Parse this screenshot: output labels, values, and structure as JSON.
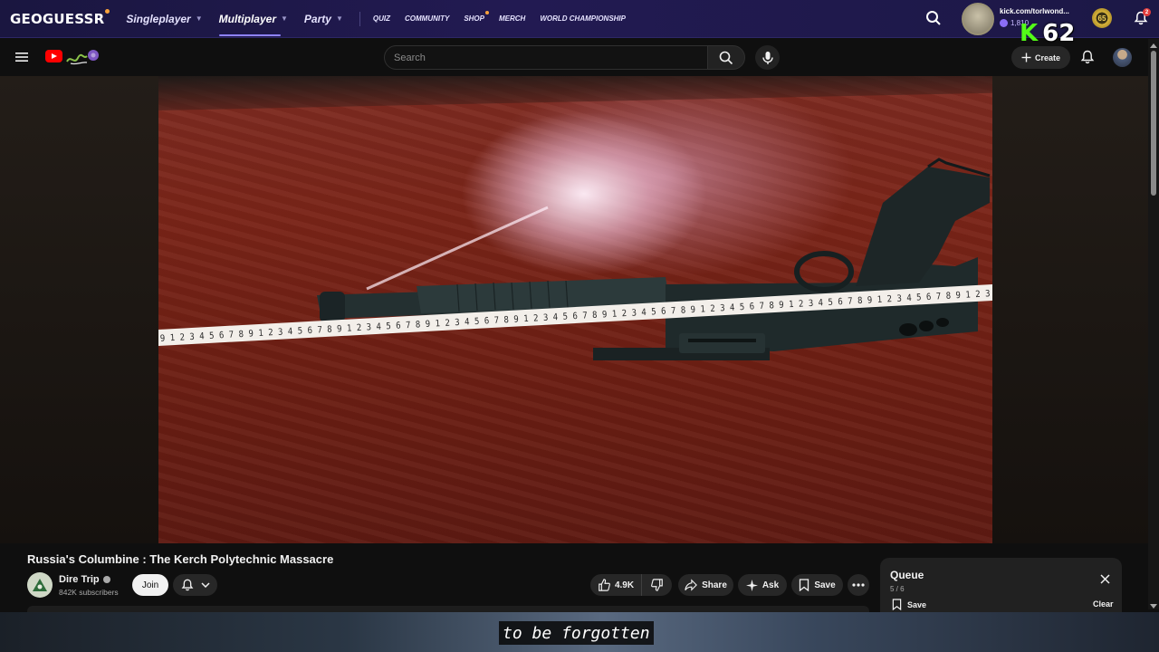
{
  "geoguessr": {
    "logo": "GEOGUESSR",
    "nav": [
      {
        "label": "Singleplayer",
        "has_dropdown": true,
        "active": false
      },
      {
        "label": "Multiplayer",
        "has_dropdown": true,
        "active": true
      },
      {
        "label": "Party",
        "has_dropdown": true,
        "active": false
      }
    ],
    "links": [
      "QUIZ",
      "COMMUNITY",
      "SHOP",
      "MERCH",
      "WORLD CHAMPIONSHIP"
    ],
    "user": "kick.com/torlwond...",
    "coins": "1,810",
    "level": "65",
    "notifications": "2"
  },
  "overlay": {
    "kick_letter": "K",
    "kick_count": "62",
    "subtitle": "to be forgotten"
  },
  "youtube": {
    "search_placeholder": "Search",
    "create_label": "Create"
  },
  "video": {
    "title": "Russia's Columbine : The Kerch Polytechnic Massacre",
    "channel": "Dire Trip",
    "subscribers": "842K subscribers",
    "join_label": "Join",
    "likes": "4.9K",
    "share_label": "Share",
    "ask_label": "Ask",
    "save_label": "Save",
    "tape_digits": "9 1 2 3 4 5 6 7 8 9 1 2 3 4 5 6 7 8 9 1 2 3 4 5 6 7 8 9 1 2 3 4 5 6 7 8 9 1 2 3 4 5 6 7 8 9 1 2 3 4 5 6 7 8 9 1 2 3 4 5 6 7 8 9 1 2 3 4 5 6 7 8 9 1 2 3 4 5 6 7 8 9 1 2 3"
  },
  "queue": {
    "title": "Queue",
    "count": "5 / 6",
    "save_label": "Save",
    "clear_label": "Clear"
  },
  "colors": {
    "geo_bar": "#221a52",
    "kick_green": "#53fc18",
    "youtube_red": "#ff0000",
    "background": "#0f0f0f"
  }
}
